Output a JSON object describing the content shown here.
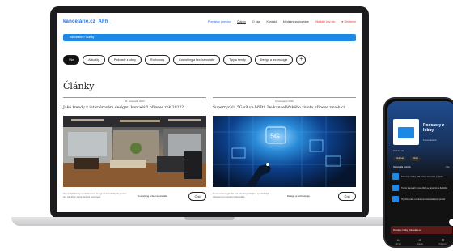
{
  "site": {
    "logo": "kancelárie.cz_AFh_",
    "nav": [
      "Prenájmy priestor",
      "Články",
      "O nás",
      "Kontakt",
      "Mediální spolupráce",
      "Hledáte jiný nic",
      "♥ Oblíbené"
    ],
    "breadcrumb": "Kancelárie > Články",
    "filters": [
      "Vše",
      "Aktuality",
      "Podcasty z lobby",
      "Rozhovory",
      "Coworking a flexi kanceláře",
      "Tipy a trendy",
      "Design a technologie"
    ],
    "filters_more": "+",
    "page_title": "Články"
  },
  "articles": [
    {
      "date": "11. listopadu 2022",
      "title": "Jaké trendy v interiérovém designu kanceláří přinese rok 2022?",
      "desc": "Nejnovější trendy v interiérovém designu kancelářských prostor pro rok 2022, které stojí za pozornost.",
      "tag": "Coworking a flexi kanceláře",
      "button": "Číst"
    },
    {
      "date": "9. listopadu 2022",
      "title": "Superrychlá 5G síť ve hřišti. Do kancelářského života přinese revoluci",
      "desc": "Nová technologie 5G sítě přináší rychlejší a spolehlivější připojení pro moderní kanceláře.",
      "tag": "Design a technologie",
      "button": "Číst"
    }
  ],
  "phone": {
    "title": "Podcasty z lobby",
    "author": "Kancelárie.cz",
    "label_about": "Podcast od",
    "pills": [
      "Sledovat",
      "Sdílet"
    ],
    "section": "Nejnovější epizody",
    "section_link": "Vše",
    "episodes": [
      "Podcasty z lobby: Jak mohou kanceláře podpořit...",
      "Trendy kanceláří v roce 2022 se zaměřují na flexibilitu",
      "Hybridní práce a budoucnost kancelářských prostor"
    ],
    "player": "Podcasty z lobby · Kancelárie.cz",
    "tabs": [
      {
        "icon": "⌂",
        "label": "Domů"
      },
      {
        "icon": "⌕",
        "label": "Hledat"
      },
      {
        "icon": "≡",
        "label": "Knihovna"
      }
    ]
  }
}
